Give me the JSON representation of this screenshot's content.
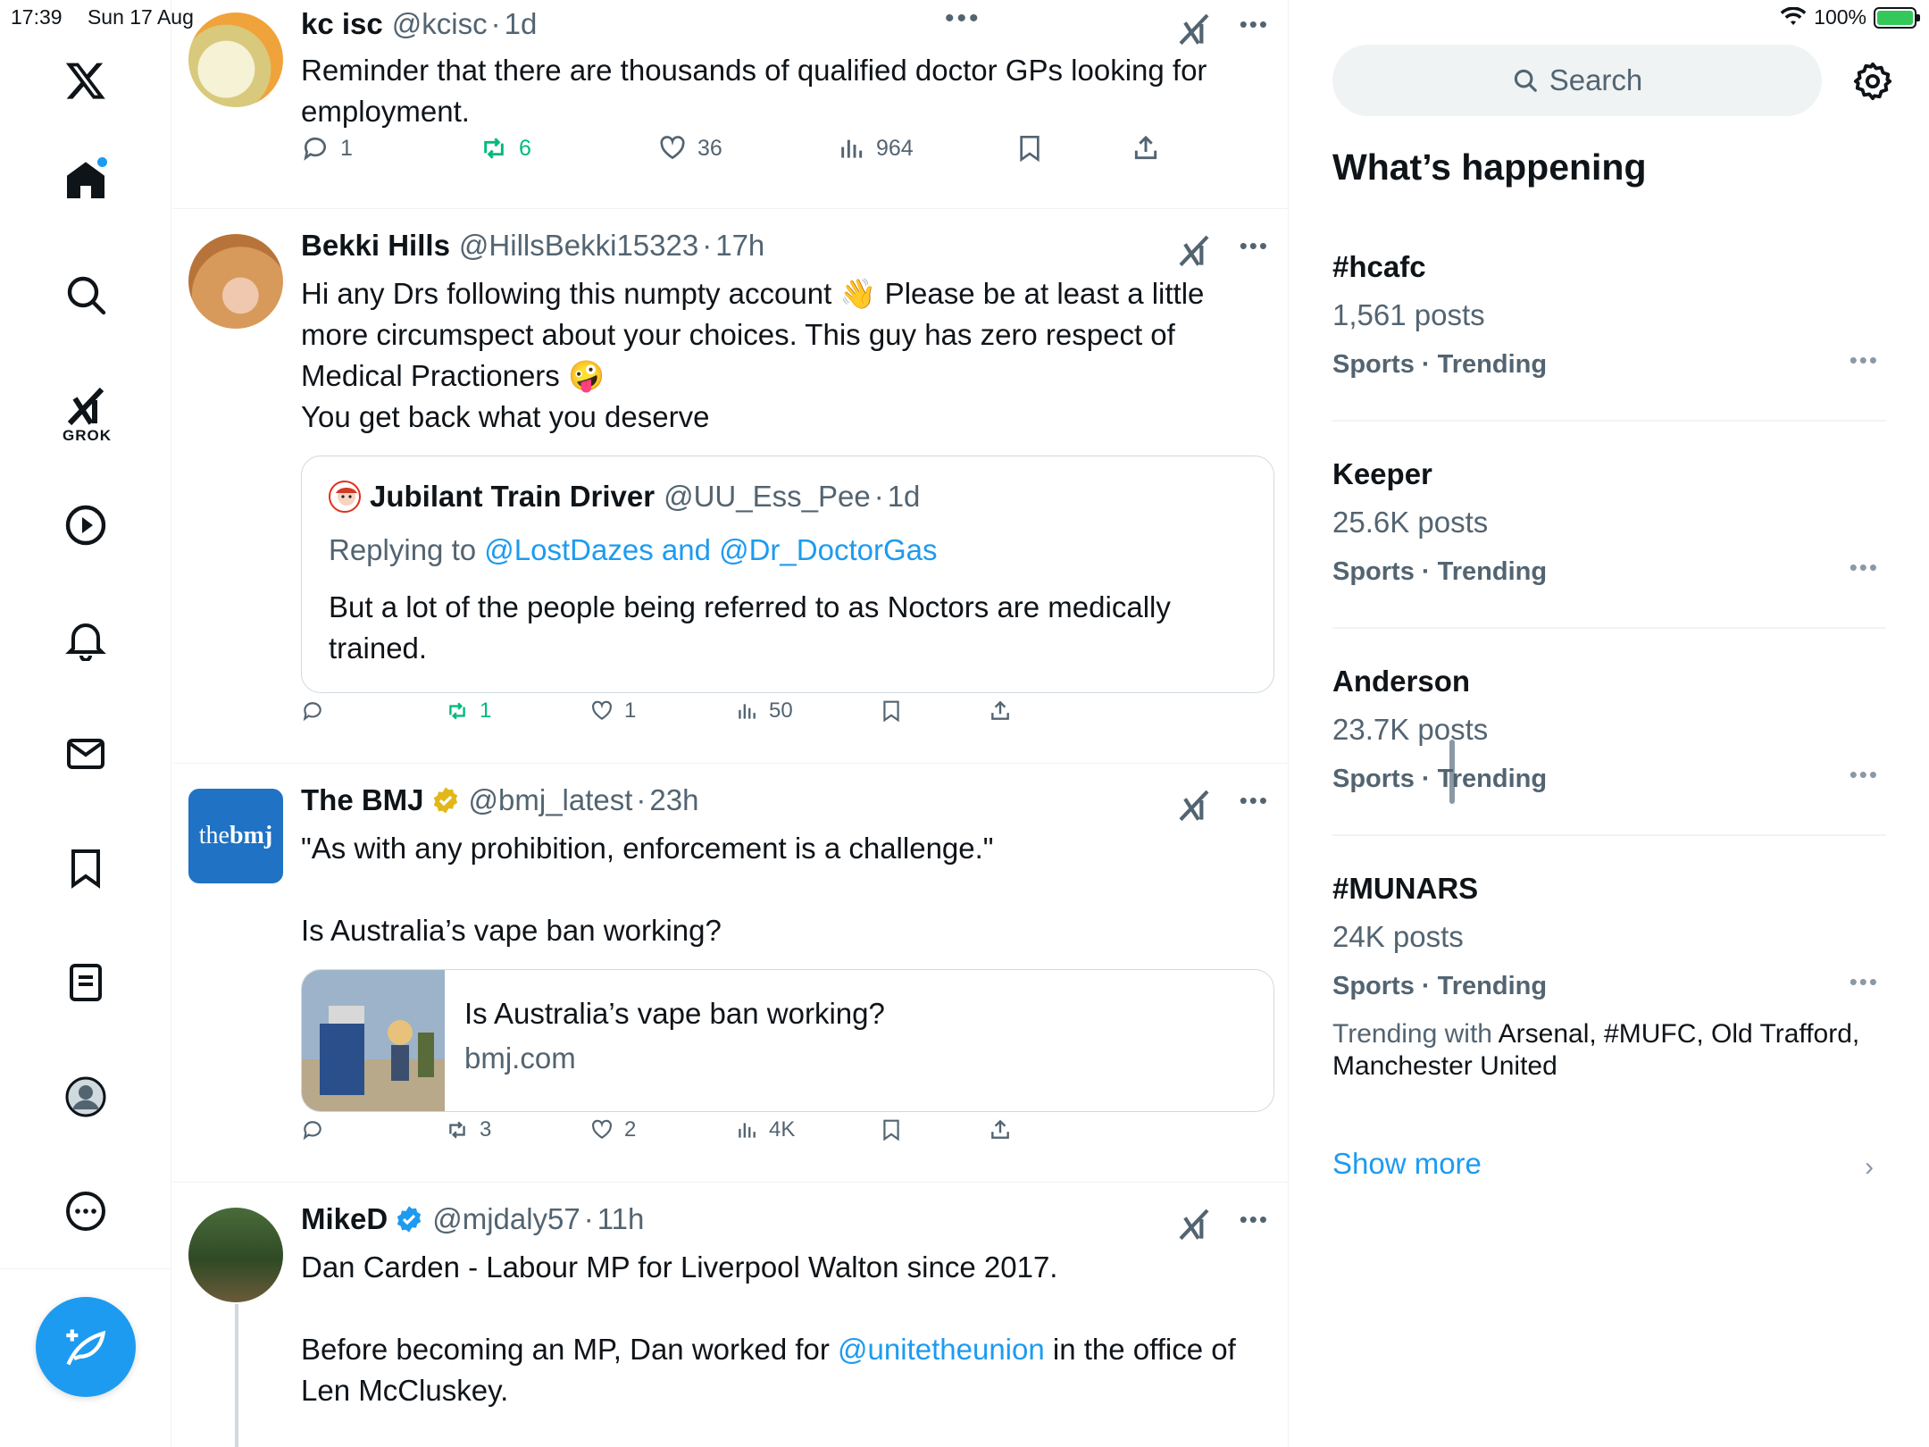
{
  "status": {
    "time": "17:39",
    "date": "Sun 17 Aug",
    "battery": "100%"
  },
  "nav": {
    "grok_label": "GROK"
  },
  "feed": {
    "tweets": [
      {
        "name": "kc isc",
        "handle": "@kcisc",
        "time": "1d",
        "text": "Reminder that there are thousands of qualified doctor GPs looking for employment.",
        "replies": "1",
        "reposts": "6",
        "likes": "36",
        "views": "964"
      },
      {
        "name": "Bekki Hills",
        "handle": "@HillsBekki15323",
        "time": "17h",
        "text_l1": "Hi any Drs following this numpty account 👋 Please be at least a little",
        "text_l2": "more circumspect about your choices. This guy has zero respect of",
        "text_l3": "Medical Practioners 🤪",
        "text_l4": "You get back what you deserve",
        "quote": {
          "name": "Jubilant Train Driver",
          "handle": "@UU_Ess_Pee",
          "time": "1d",
          "replying_label": "Replying to",
          "replying_to": "@LostDazes and @Dr_DoctorGas",
          "text": "But a lot of the people being referred to as Noctors are medically trained."
        },
        "replies": "",
        "reposts": "1",
        "likes": "1",
        "views": "50"
      },
      {
        "name": "The BMJ",
        "handle": "@bmj_latest",
        "time": "23h",
        "avatar_text_a": "the",
        "avatar_text_b": "bmj",
        "text_l1": "\"As with any prohibition, enforcement is a challenge.\"",
        "text_l2": "Is Australia’s vape ban working?",
        "card": {
          "title": "Is Australia’s vape ban working?",
          "domain": "bmj.com"
        },
        "replies": "",
        "reposts": "3",
        "likes": "2",
        "views": "4K"
      },
      {
        "name": "MikeD",
        "handle": "@mjdaly57",
        "time": "11h",
        "text_l1": "Dan Carden - Labour MP for Liverpool Walton since 2017.",
        "text_l2a": "Before becoming an MP, Dan worked for ",
        "text_l2_link": "@unitetheunion",
        "text_l2b": " in the office of",
        "text_l3": "Len McCluskey."
      }
    ]
  },
  "sidebar": {
    "search_placeholder": "Search",
    "title": "What’s happening",
    "trends": [
      {
        "tag": "#hcafc",
        "count": "1,561 posts",
        "category": "Sports · Trending"
      },
      {
        "tag": "Keeper",
        "count": "25.6K posts",
        "category": "Sports · Trending"
      },
      {
        "tag": "Anderson",
        "count": "23.7K posts",
        "category": "Sports · Trending"
      },
      {
        "tag": "#MUNARS",
        "count": "24K posts",
        "category": "Sports · Trending",
        "with_label": "Trending with",
        "with_items": "Arsenal, #MUFC, Old Trafford, Manchester United"
      }
    ],
    "show_more": "Show more"
  },
  "colors": {
    "accent": "#1d9bf0",
    "repost_green": "#00ba7c",
    "muted": "#536471",
    "gold_badge": "#e2b719"
  }
}
